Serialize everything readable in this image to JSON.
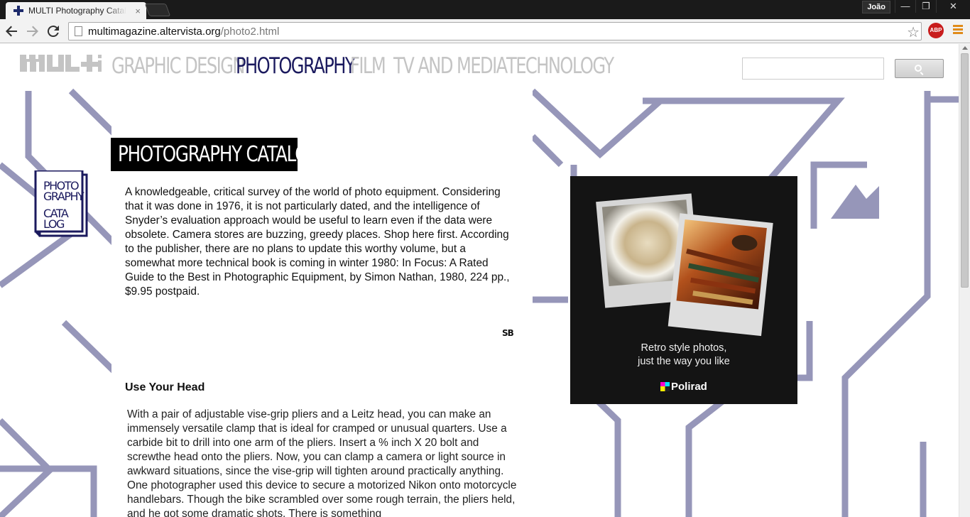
{
  "browser": {
    "tab_title": "MULTI Photography Catal",
    "tab_close": "×",
    "user": "João",
    "url_host": "multimagazine.altervista.org",
    "url_path": "/photo2.html",
    "abp_label": "ABP",
    "win_minimize": "—",
    "win_restore": "❐",
    "win_close": "✕",
    "back_icon": "arrow-left-icon",
    "forward_icon": "arrow-right-icon",
    "reload_icon": "reload-icon"
  },
  "site": {
    "logo": "MULTI",
    "nav": [
      {
        "label": "GRAPHIC DESIGN",
        "active": false
      },
      {
        "label": "PHOTOGRAPHY",
        "active": true
      },
      {
        "label": "FILM",
        "active": false
      },
      {
        "label": "TV AND MEDIA",
        "active": false
      },
      {
        "label": "TECHNOLOGY",
        "active": false
      }
    ],
    "search_placeholder": ""
  },
  "article": {
    "title": "PHOTOGRAPHY CATALOG",
    "book_label_1": "PHOTO",
    "book_label_2": "GRAPHY",
    "book_label_3": "CATA",
    "book_label_4": "LOG",
    "body": "A knowledgeable, critical survey of the world of photo equipment. Considering that it was done in 1976, it is not particularly dated, and the intelligence of Snyder’s evaluation approach would be useful to learn even if the data were obsolete. Camera stores are buzzing, greedy places. Shop here first. According to the publisher, there are no plans to update this worthy volume, but a somewhat more technical book is coming in winter 1980: In Focus: A Rated Guide to the Best in Photographic Equipment, by Simon Nathan, 1980, 224 pp., $9.95 postpaid.",
    "signature": "SB",
    "section2_title": "Use Your Head",
    "section2_body": "With a pair of adjustable vise-grip pliers and a Leitz head, you can make an immensely versatile clamp that is ideal for cramped or unusual quarters. Use a carbide bit to drill into one arm of the pliers. Insert a % inch X 20 bolt and screwthe head onto the pliers. Now, you can clamp a camera or light source in awkward situations, since the vise-grip will tighten around practically anything. One photographer used this device to secure a motorized Nikon onto motorcycle handlebars. Though the bike scrambled over some rough terrain, the pliers held, and he got some dramatic shots. There is something"
  },
  "ad": {
    "caption_line1": "Retro style photos,",
    "caption_line2": "just the way you like",
    "brand": "Polirad"
  },
  "colors": {
    "accent_navy": "#1b1a5e",
    "nav_inactive": "#c4c4c4",
    "pattern": "#9696b9"
  }
}
